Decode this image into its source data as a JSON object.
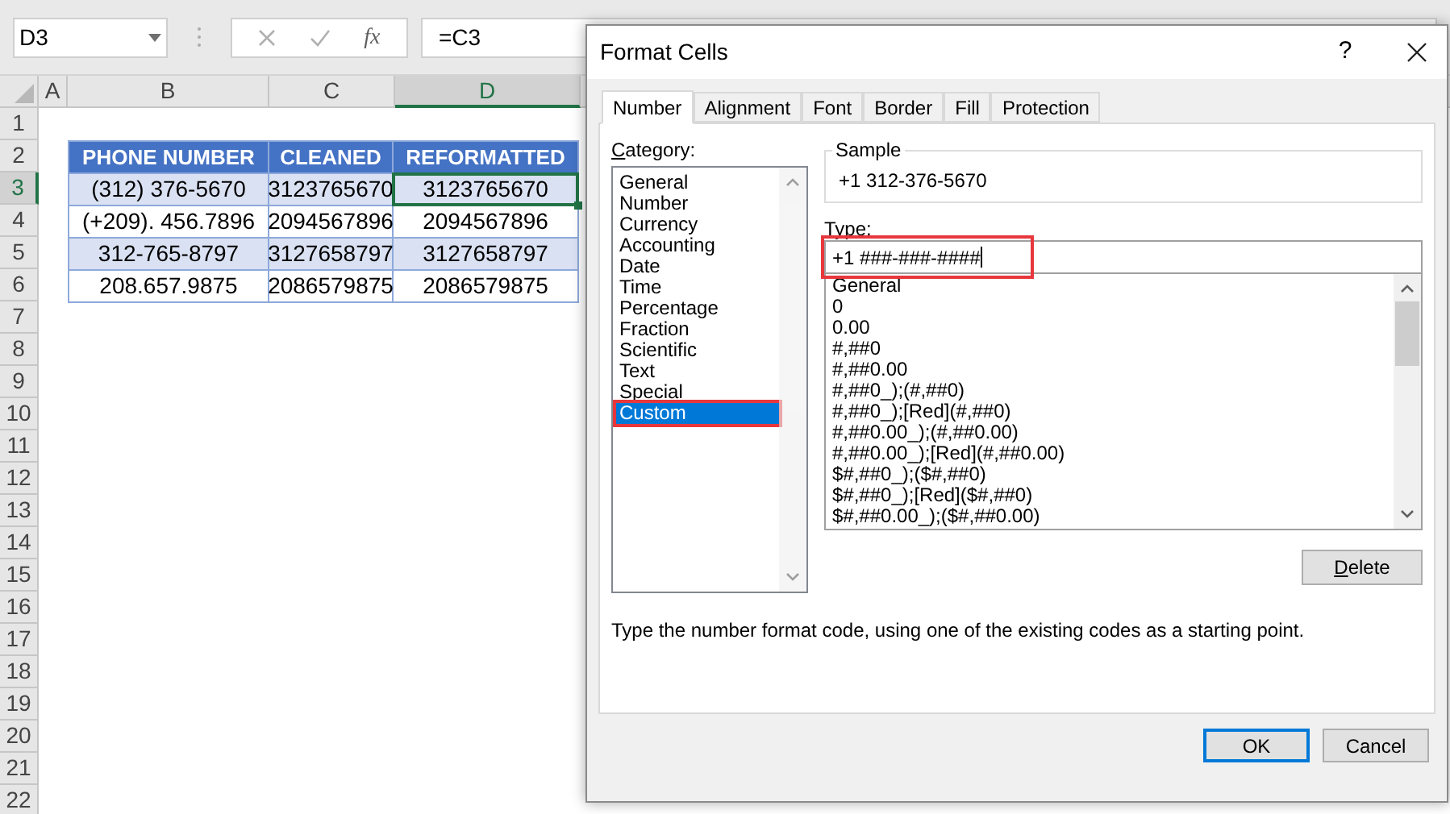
{
  "name_box": {
    "value": "D3"
  },
  "formula_bar": {
    "function_label": "fx",
    "formula": "=C3"
  },
  "columns": [
    {
      "label": "A",
      "selected": false
    },
    {
      "label": "B",
      "selected": false
    },
    {
      "label": "C",
      "selected": false
    },
    {
      "label": "D",
      "selected": true
    }
  ],
  "rows": [
    {
      "label": "1",
      "selected": false
    },
    {
      "label": "2",
      "selected": false
    },
    {
      "label": "3",
      "selected": true
    },
    {
      "label": "4",
      "selected": false
    },
    {
      "label": "5",
      "selected": false
    },
    {
      "label": "6",
      "selected": false
    },
    {
      "label": "7",
      "selected": false
    },
    {
      "label": "8",
      "selected": false
    },
    {
      "label": "9",
      "selected": false
    },
    {
      "label": "10",
      "selected": false
    },
    {
      "label": "11",
      "selected": false
    },
    {
      "label": "12",
      "selected": false
    },
    {
      "label": "13",
      "selected": false
    },
    {
      "label": "14",
      "selected": false
    },
    {
      "label": "15",
      "selected": false
    },
    {
      "label": "16",
      "selected": false
    },
    {
      "label": "17",
      "selected": false
    },
    {
      "label": "18",
      "selected": false
    },
    {
      "label": "19",
      "selected": false
    },
    {
      "label": "20",
      "selected": false
    },
    {
      "label": "21",
      "selected": false
    },
    {
      "label": "22",
      "selected": false
    }
  ],
  "table": {
    "headers": [
      "PHONE NUMBER",
      "CLEANED",
      "REFORMATTED"
    ],
    "rows": [
      {
        "banded": true,
        "cells": [
          {
            "text": "(312) 376-5670",
            "selected": false
          },
          {
            "text": "3123765670",
            "selected": false
          },
          {
            "text": "3123765670",
            "selected": true
          }
        ]
      },
      {
        "banded": false,
        "cells": [
          {
            "text": "(+209). 456.7896",
            "selected": false
          },
          {
            "text": "2094567896",
            "selected": false
          },
          {
            "text": "2094567896",
            "selected": false
          }
        ]
      },
      {
        "banded": true,
        "cells": [
          {
            "text": "312-765-8797",
            "selected": false
          },
          {
            "text": "3127658797",
            "selected": false
          },
          {
            "text": "3127658797",
            "selected": false
          }
        ]
      },
      {
        "banded": false,
        "cells": [
          {
            "text": "208.657.9875",
            "selected": false
          },
          {
            "text": "2086579875",
            "selected": false
          },
          {
            "text": "2086579875",
            "selected": false
          }
        ]
      }
    ]
  },
  "dialog": {
    "title": "Format Cells",
    "help": "?",
    "tabs": [
      {
        "label": "Number",
        "selected": true
      },
      {
        "label": "Alignment",
        "selected": false
      },
      {
        "label": "Font",
        "selected": false
      },
      {
        "label": "Border",
        "selected": false
      },
      {
        "label": "Fill",
        "selected": false
      },
      {
        "label": "Protection",
        "selected": false
      }
    ],
    "category_label": "Category:",
    "categories": [
      {
        "label": "General",
        "selected": false,
        "highlighted": false
      },
      {
        "label": "Number",
        "selected": false,
        "highlighted": false
      },
      {
        "label": "Currency",
        "selected": false,
        "highlighted": false
      },
      {
        "label": "Accounting",
        "selected": false,
        "highlighted": false
      },
      {
        "label": "Date",
        "selected": false,
        "highlighted": false
      },
      {
        "label": "Time",
        "selected": false,
        "highlighted": false
      },
      {
        "label": "Percentage",
        "selected": false,
        "highlighted": false
      },
      {
        "label": "Fraction",
        "selected": false,
        "highlighted": false
      },
      {
        "label": "Scientific",
        "selected": false,
        "highlighted": false
      },
      {
        "label": "Text",
        "selected": false,
        "highlighted": false
      },
      {
        "label": "Special",
        "selected": false,
        "highlighted": false
      },
      {
        "label": "Custom",
        "selected": true,
        "highlighted": true
      }
    ],
    "sample": {
      "label": "Sample",
      "value": "+1 312-376-5670"
    },
    "type": {
      "label": "Type:",
      "value": "+1 ###-###-####",
      "highlighted": true
    },
    "formats": [
      "General",
      "0",
      "0.00",
      "#,##0",
      "#,##0.00",
      "#,##0_);(#,##0)",
      "#,##0_);[Red](#,##0)",
      "#,##0.00_);(#,##0.00)",
      "#,##0.00_);[Red](#,##0.00)",
      "$#,##0_);($#,##0)",
      "$#,##0_);[Red]($#,##0)",
      "$#,##0.00_);($#,##0.00)"
    ],
    "delete_button": "Delete",
    "description": "Type the number format code, using one of the existing codes as a starting point.",
    "buttons": [
      {
        "label": "OK",
        "default": true
      },
      {
        "label": "Cancel",
        "default": false
      }
    ]
  }
}
